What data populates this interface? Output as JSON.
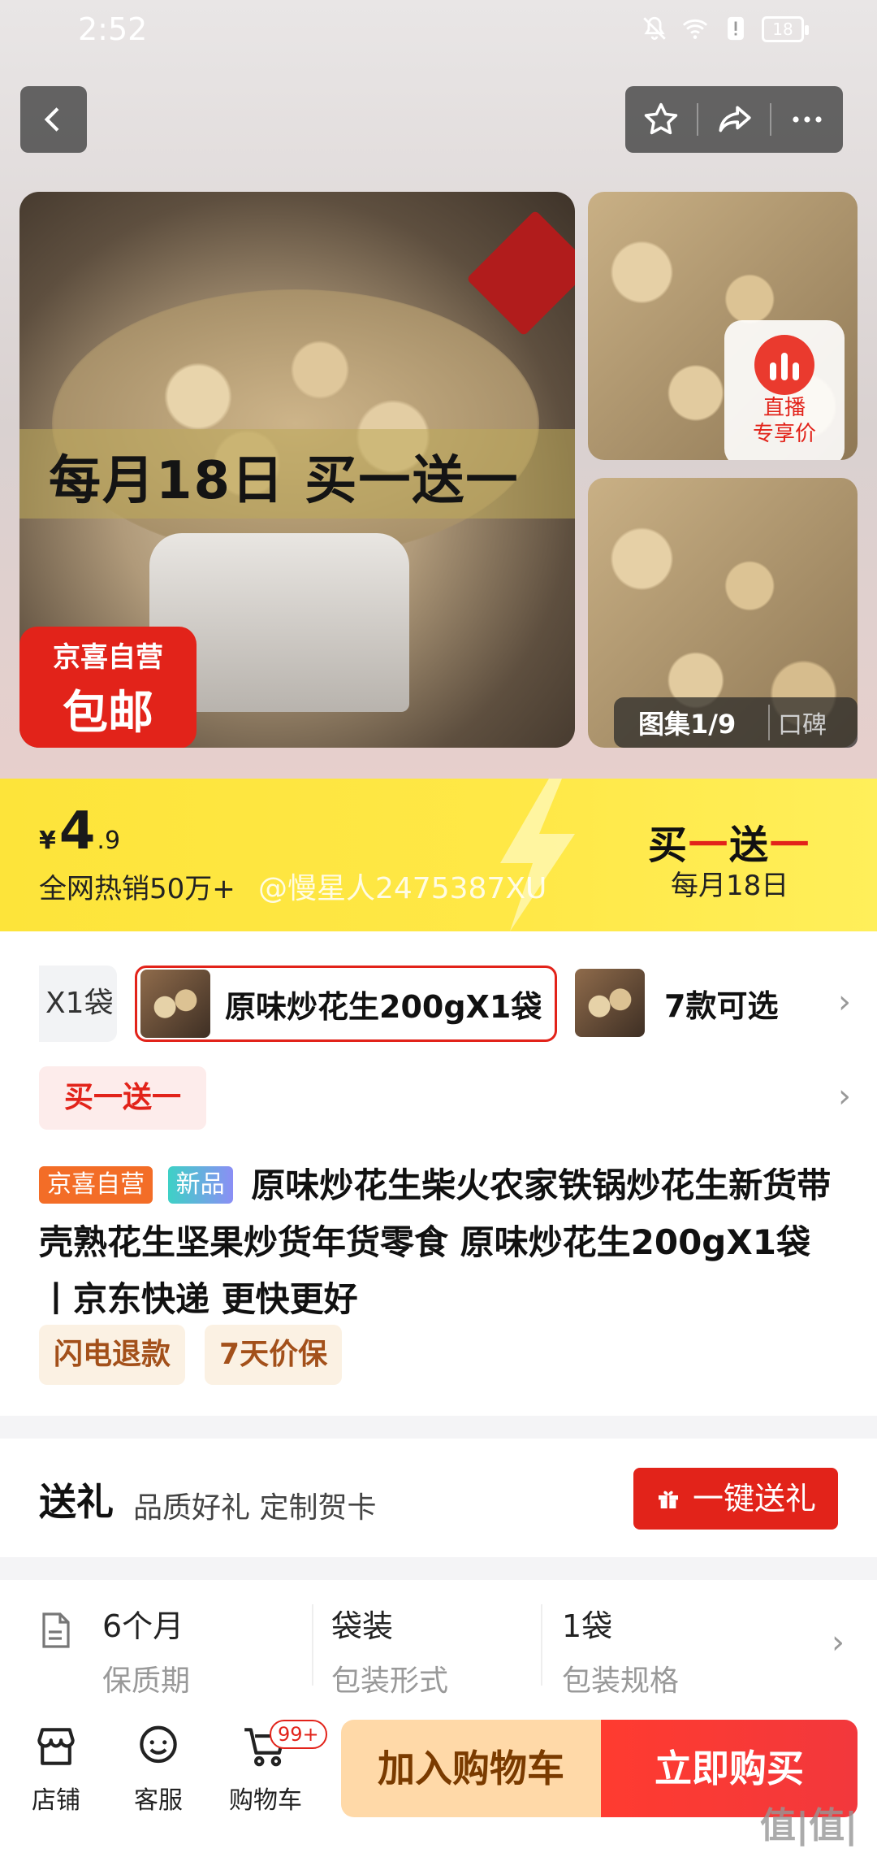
{
  "status": {
    "time": "2:52",
    "battery": "18"
  },
  "hero": {
    "banner_text": "每月18日 买一送一",
    "badge_line1": "京喜自营",
    "badge_line2": "包邮",
    "live_line1": "直播",
    "live_line2": "专享价",
    "gallery": "图集1/9",
    "reviews": "口碑"
  },
  "price": {
    "currency": "¥",
    "integer": "4",
    "decimal": ".9",
    "hot_sales": "全网热销50万+",
    "watermark": "@慢星人2475387XU",
    "promo_a": "买",
    "promo_b": "一",
    "promo_c": "送",
    "promo_d": "一",
    "promo_sub": "每月18日"
  },
  "sku": {
    "prev_label": "X1袋",
    "selected_label": "原味炒花生200gX1袋",
    "more_label": "7款可选"
  },
  "promo_tag": "买一送一",
  "title": {
    "tag_self": "京喜自营",
    "tag_new": "新品",
    "text": "原味炒花生柴火农家铁锅炒花生新货带壳熟花生坚果炒货年货零食 原味炒花生200gX1袋丨京东快递 更快更好"
  },
  "services": [
    "闪电退款",
    "7天价保"
  ],
  "gift": {
    "title": "送礼",
    "subtitle": "品质好礼 定制贺卡",
    "button": "一键送礼"
  },
  "specs": [
    {
      "value": "6个月",
      "key": "保质期"
    },
    {
      "value": "袋装",
      "key": "包装形式"
    },
    {
      "value": "1袋",
      "key": "包装规格"
    }
  ],
  "bottom": {
    "store": "店铺",
    "service": "客服",
    "cart": "购物车",
    "cart_count": "99+",
    "add_cart": "加入购物车",
    "buy_now": "立即购买"
  },
  "site_watermark": "值|值|值",
  "colors": {
    "accent_red": "#e2231a",
    "price_yellow": "#fde43a"
  }
}
